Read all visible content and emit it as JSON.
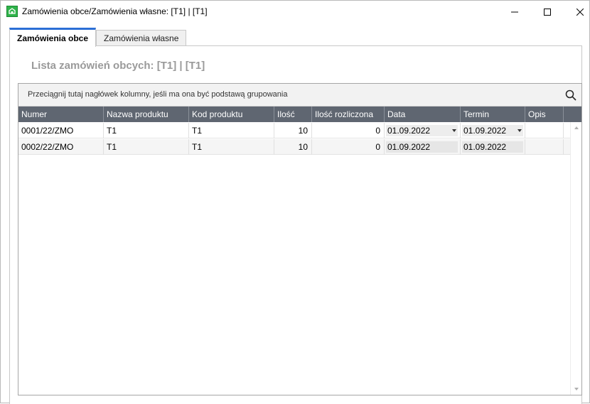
{
  "window": {
    "title": "Zamówienia obce/Zamówienia własne: [T1] | [T1]",
    "accent_color": "#2b6fd6"
  },
  "tabs": [
    {
      "label": "Zamówienia obce",
      "active": true
    },
    {
      "label": "Zamówienia własne",
      "active": false
    }
  ],
  "list_title": "Lista zamówień obcych: [T1] | [T1]",
  "grid": {
    "group_hint": "Przeciągnij tutaj nagłówek kolumny, jeśli ma ona być podstawą grupowania",
    "columns": [
      "Numer",
      "Nazwa produktu",
      "Kod produktu",
      "Ilość",
      "Ilość rozliczona",
      "Data",
      "Termin",
      "Opis"
    ],
    "rows": [
      {
        "numer": "0001/22/ZMO",
        "nazwa": "T1",
        "kod": "T1",
        "ilosc": "10",
        "rozliczona": "0",
        "data": "01.09.2022",
        "termin": "01.09.2022",
        "opis": ""
      },
      {
        "numer": "0002/22/ZMO",
        "nazwa": "T1",
        "kod": "T1",
        "ilosc": "10",
        "rozliczona": "0",
        "data": "01.09.2022",
        "termin": "01.09.2022",
        "opis": ""
      }
    ]
  }
}
